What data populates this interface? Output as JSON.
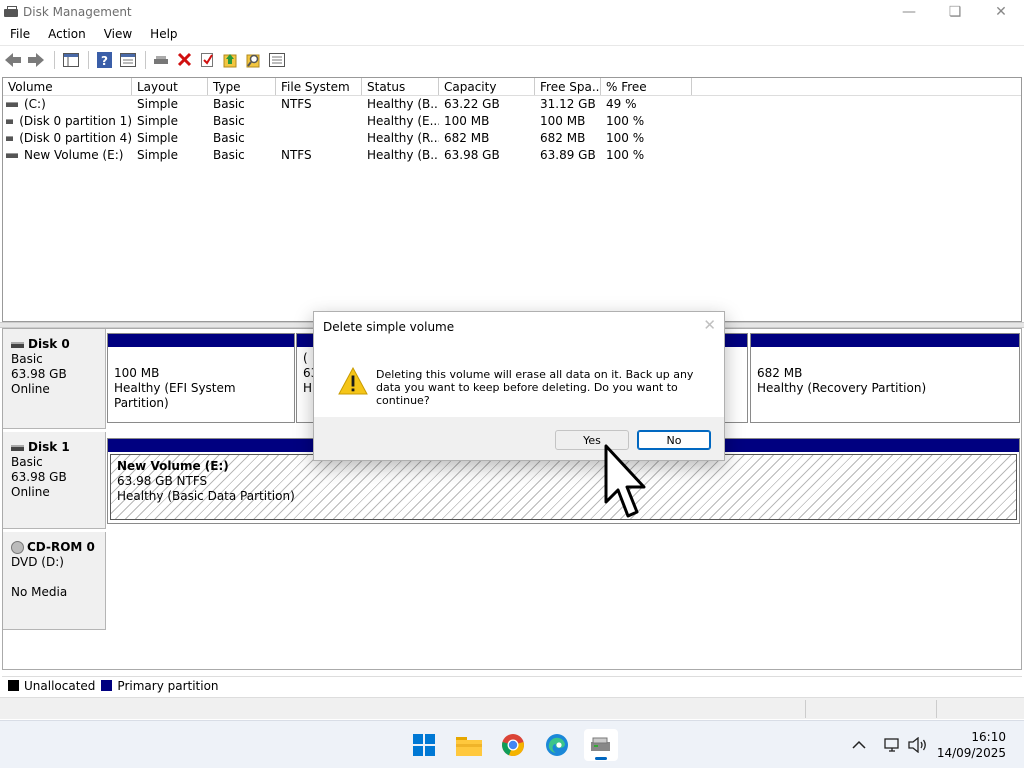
{
  "window": {
    "title": "Disk Management"
  },
  "menu": [
    "File",
    "Action",
    "View",
    "Help"
  ],
  "volume_list": {
    "columns": [
      "Volume",
      "Layout",
      "Type",
      "File System",
      "Status",
      "Capacity",
      "Free Spa...",
      "% Free"
    ],
    "rows": [
      [
        "(C:)",
        "Simple",
        "Basic",
        "NTFS",
        "Healthy (B...",
        "63.22 GB",
        "31.12 GB",
        "49 %"
      ],
      [
        "(Disk 0 partition 1)",
        "Simple",
        "Basic",
        "",
        "Healthy (E...",
        "100 MB",
        "100 MB",
        "100 %"
      ],
      [
        "(Disk 0 partition 4)",
        "Simple",
        "Basic",
        "",
        "Healthy (R...",
        "682 MB",
        "682 MB",
        "100 %"
      ],
      [
        "New Volume (E:)",
        "Simple",
        "Basic",
        "NTFS",
        "Healthy (B...",
        "63.98 GB",
        "63.89 GB",
        "100 %"
      ]
    ]
  },
  "disks": {
    "disk0": {
      "name": "Disk 0",
      "type": "Basic",
      "size": "63.98 GB",
      "state": "Online",
      "partitions": [
        {
          "size": "100 MB",
          "status": "Healthy (EFI System Partition)"
        },
        {
          "label": "(",
          "size": "63",
          "status": "H"
        },
        {
          "size": "682 MB",
          "status": "Healthy (Recovery Partition)"
        }
      ]
    },
    "disk1": {
      "name": "Disk 1",
      "type": "Basic",
      "size": "63.98 GB",
      "state": "Online",
      "partition": {
        "label": "New Volume  (E:)",
        "size": "63.98 GB NTFS",
        "status": "Healthy (Basic Data Partition)"
      }
    },
    "cdrom0": {
      "name": "CD-ROM 0",
      "type": "DVD (D:)",
      "state": "No Media"
    }
  },
  "legend": {
    "unallocated": "Unallocated",
    "primary": "Primary partition",
    "unallocated_color": "#000000",
    "primary_color": "#000080"
  },
  "dialog": {
    "title": "Delete simple volume",
    "message": "Deleting this volume will erase all data on it. Back up any data you want to keep before deleting. Do you want to continue?",
    "yes": "Yes",
    "no": "No",
    "icon": "warning-icon"
  },
  "taskbar": {
    "apps": [
      "start-icon",
      "file-explorer-icon",
      "chrome-icon",
      "edge-icon",
      "disk-management-icon"
    ],
    "time": "16:10",
    "date": "14/09/2025"
  }
}
